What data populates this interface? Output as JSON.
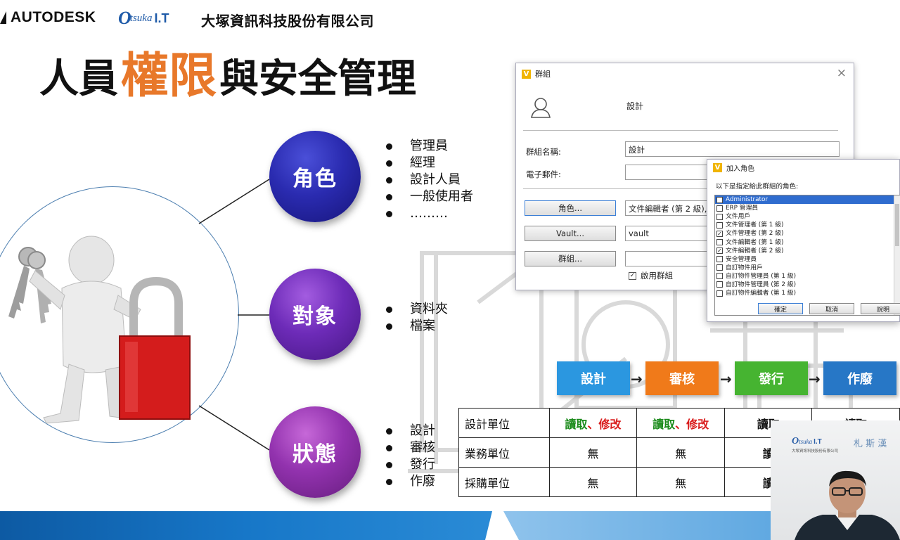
{
  "header": {
    "autodesk_logo": "AUTODESK",
    "otsuka_logo_o": "O",
    "otsuka_logo_tsuka": "tsuka",
    "otsuka_logo_it": "I.T",
    "company_name": "大塚資訊科技股份有限公司"
  },
  "title": {
    "part1": "人員",
    "part2": "權限",
    "part3": "與安全管理"
  },
  "categories": {
    "role": {
      "label": "角色",
      "items": [
        "管理員",
        "經理",
        "設計人員",
        "一般使用者",
        "………"
      ]
    },
    "object": {
      "label": "對象",
      "items": [
        "資料夾",
        "檔案"
      ]
    },
    "state": {
      "label": "狀態",
      "items": [
        "設計",
        "審核",
        "發行",
        "作廢"
      ]
    }
  },
  "group_dialog": {
    "title": "群組",
    "close": "×",
    "header_name": "設計",
    "group_name_label": "群組名稱:",
    "group_name_value": "設計",
    "email_label": "電子郵件:",
    "email_value": "",
    "role_button": "角色...",
    "role_value": "文件編輯者 (第 2 級),文",
    "vault_button": "Vault...",
    "vault_value": "vault",
    "group_button": "群組...",
    "group_value": "",
    "enable_label": "啟用群組",
    "enable_checked": true
  },
  "role_dialog": {
    "title": "加入角色",
    "intro": "以下是指定給此群組的角色:",
    "roles": [
      {
        "name": "Administrator",
        "checked": false,
        "selected": true
      },
      {
        "name": "ERP 管理員",
        "checked": false,
        "selected": false
      },
      {
        "name": "文件用戶",
        "checked": false,
        "selected": false
      },
      {
        "name": "文件管理者 (第 1 級)",
        "checked": false,
        "selected": false
      },
      {
        "name": "文件管理者 (第 2 級)",
        "checked": true,
        "selected": false
      },
      {
        "name": "文件編輯者 (第 1 級)",
        "checked": false,
        "selected": false
      },
      {
        "name": "文件編輯者 (第 2 級)",
        "checked": true,
        "selected": false
      },
      {
        "name": "安全管理員",
        "checked": false,
        "selected": false
      },
      {
        "name": "自訂物件用戶",
        "checked": false,
        "selected": false
      },
      {
        "name": "自訂物件管理員 (第 1 級)",
        "checked": false,
        "selected": false
      },
      {
        "name": "自訂物件管理員 (第 2 級)",
        "checked": false,
        "selected": false
      },
      {
        "name": "自訂物件編輯者 (第 1 級)",
        "checked": false,
        "selected": false
      }
    ],
    "ok_button": "確定",
    "cancel_button": "取消",
    "help_button": "說明"
  },
  "workflow": {
    "steps": [
      "設計",
      "審核",
      "發行",
      "作廢"
    ],
    "arrow": "→",
    "colors": [
      "#2b97e0",
      "#f07a1a",
      "#46b431",
      "#2777c6"
    ]
  },
  "permission_table": {
    "rows": [
      {
        "unit": "設計單位",
        "c1_read": "讀取",
        "c1_sep": "、",
        "c1_edit": "修改",
        "c2_read": "讀取",
        "c2_sep": "、",
        "c2_edit": "修改",
        "c3": "讀取",
        "c4": "讀取"
      },
      {
        "unit": "業務單位",
        "c1": "無",
        "c2": "無",
        "c3": "讀"
      },
      {
        "unit": "採購單位",
        "c1": "無",
        "c2": "無",
        "c3": "讀"
      }
    ]
  },
  "webcam": {
    "logo_o": "O",
    "logo_tsuka": "tsuka",
    "logo_it": "I.T",
    "company": "大塚資訊科技股份有限公司",
    "sign": "札 斯 漢"
  }
}
